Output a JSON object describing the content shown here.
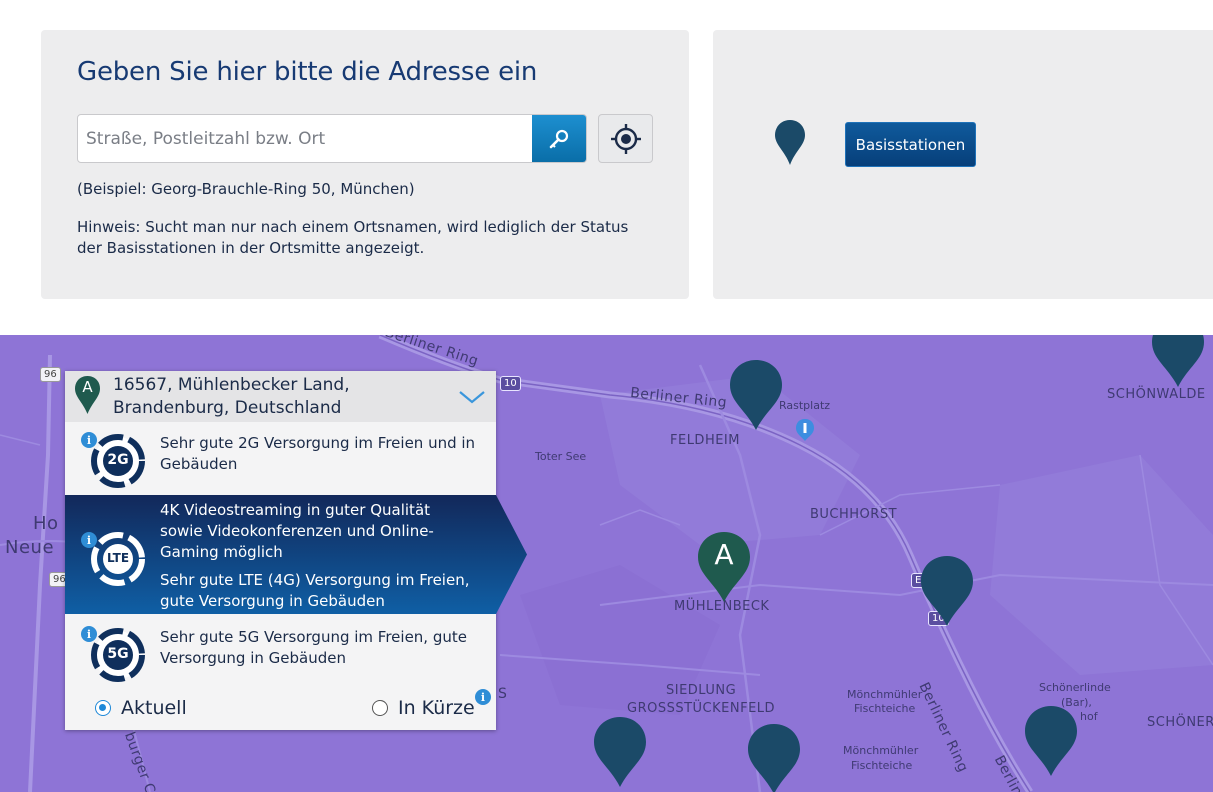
{
  "search_panel": {
    "title": "Geben Sie hier bitte die Adresse ein",
    "input_placeholder": "Straße, Postleitzahl bzw. Ort",
    "search_icon": "search-key-icon",
    "locate_icon": "crosshair-icon",
    "example": "(Beispiel: Georg-Brauchle-Ring 50, München)",
    "hint": "Hinweis: Sucht man nur nach einem Ortsnamen, wird lediglich der Status der Basisstationen in der Ortsmitte angezeigt."
  },
  "legend_panel": {
    "pin_icon": "map-pin-icon",
    "stations_button": "Basisstationen"
  },
  "coverage_card": {
    "address_line1": "16567, Mühlenbecker Land,",
    "address_line2": "Brandenburg, Deutschland",
    "pin_letter": "A",
    "rows": [
      {
        "badge": "2G",
        "text": "Sehr gute 2G Versorgung im Freien und in Gebäuden",
        "fill": 0.75
      },
      {
        "badge": "LTE",
        "headline": "4K Videostreaming in guter Qualität sowie Videokonferenzen und Online-Gaming möglich",
        "text": "Sehr gute LTE (4G) Versorgung im Freien, gute Versorgung in Gebäuden",
        "fill": 0.75
      },
      {
        "badge": "5G",
        "text": "Sehr gute 5G Versorgung im Freien, gute Versorgung in Gebäuden",
        "fill": 0.75
      }
    ],
    "radio_current": "Aktuell",
    "radio_soon": "In Kürze",
    "selected": "Aktuell"
  },
  "map": {
    "labels": {
      "feldheim": "FELDHEIM",
      "buchhorst": "BUCHHORST",
      "muehlenbeck": "MÜHLENBECK",
      "siedlung1": "SIEDLUNG",
      "siedlung2": "GROSSSTÜCKENFELD",
      "schoenwalde": "SCHÖNWALDE",
      "schoener": "SCHÖNER",
      "toter_see": "Toter See",
      "rastplatz": "Rastplatz",
      "fisch1a": "Mönchmühler",
      "fisch1b": "Fischteiche",
      "fisch2a": "Mönchmühler",
      "fisch2b": "Fischteiche",
      "schoenerlinde1": "Schönerlinde",
      "schoenerlinde2": "(Bar),",
      "schoenerlinde3": "hof",
      "ho": "Ho",
      "neue": "Neue",
      "s_frag": "S",
      "berliner_ring_top": "Berliner Ring",
      "berliner_ring_mid": "Berliner Ring",
      "berliner_ring_diag": "Berliner Ring",
      "berlin_frag": "Berlin",
      "burger_ch": "burger Ch",
      "shield_96a": "96",
      "shield_96b": "96",
      "shield_10": "10",
      "shield_e": "E",
      "shield_10b": "10"
    },
    "selected_pin_letter": "A"
  },
  "colors": {
    "map_fill": "#8e74d6",
    "pin": "#1b4a68",
    "pin_selected": "#1f5a4e",
    "accent_blue": "#1e88d8",
    "active_row": "#0f3d78"
  }
}
